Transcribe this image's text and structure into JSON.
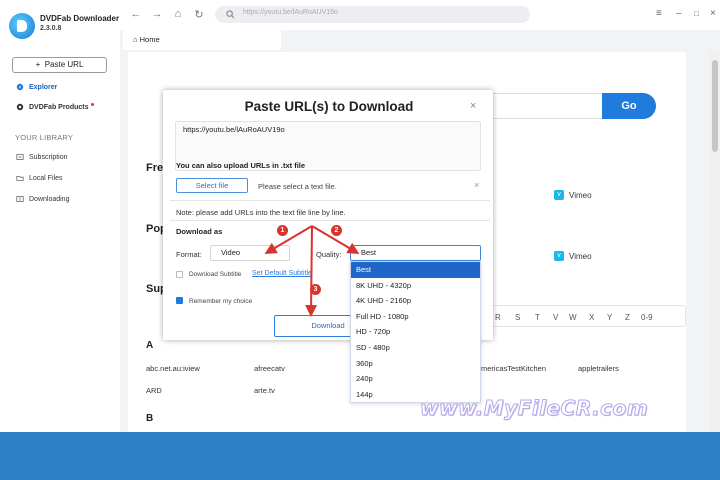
{
  "app": {
    "name": "DVDFab Downloader",
    "version": "2.3.0.8"
  },
  "sidebar": {
    "paste_label": "Paste URL",
    "items": [
      {
        "label": "Explorer",
        "icon": "explorer-icon"
      },
      {
        "label": "DVDFab Products",
        "icon": "products-icon"
      }
    ],
    "library_heading": "YOUR LIBRARY",
    "library_items": [
      {
        "label": "Subscription",
        "icon": "subscription-icon"
      },
      {
        "label": "Local Files",
        "icon": "folder-icon"
      },
      {
        "label": "Downloading",
        "icon": "download-icon"
      }
    ]
  },
  "topbar": {
    "url": "https://youtu.be/lAuRoAUV19o"
  },
  "tab": {
    "label": "Home"
  },
  "main": {
    "go_label": "Go",
    "sections": [
      "Free",
      "Pop",
      "Sup"
    ],
    "sites_row1_partial": "am",
    "vimeo": "Vimeo",
    "letters": [
      "R",
      "S",
      "T",
      "V",
      "W",
      "X",
      "Y",
      "Z",
      "0-9"
    ],
    "group_a": "A",
    "a_sites": [
      "abc.net.au:iview",
      "afreecatv",
      "mericasTestKitchen",
      "appletrailers",
      "ARD",
      "arte.tv"
    ],
    "group_b": "B"
  },
  "dialog": {
    "title": "Paste URL(s) to Download",
    "url_value": "https://youtu.be/lAuRoAUV19o",
    "upload_note": "You can also upload URLs in .txt file",
    "select_file": "Select file",
    "select_hint": "Please select a text file.",
    "note": "Note: please add URLs into the text file line by line.",
    "download_as": "Download as",
    "format_label": "Format:",
    "format_value": "Video",
    "quality_label": "Quality:",
    "quality_value": "Best",
    "subtitle_label": "Download Subtitle",
    "subtitle_link": "Set Default Subtitle",
    "remember_label": "Remember my choice",
    "download_label": "Download",
    "subtitle_checked": false,
    "remember_checked": true
  },
  "quality_options": [
    "Best",
    "8K UHD - 4320p",
    "4K UHD - 2160p",
    "Full HD - 1080p",
    "HD - 720p",
    "SD - 480p",
    "360p",
    "240p",
    "144p"
  ],
  "annotations": [
    "1",
    "2",
    "3"
  ],
  "watermark": "www.MyFileCR.com",
  "colors": {
    "accent": "#1f7bdc",
    "arrow": "#d9342b",
    "banner": "#2f7fc6"
  }
}
